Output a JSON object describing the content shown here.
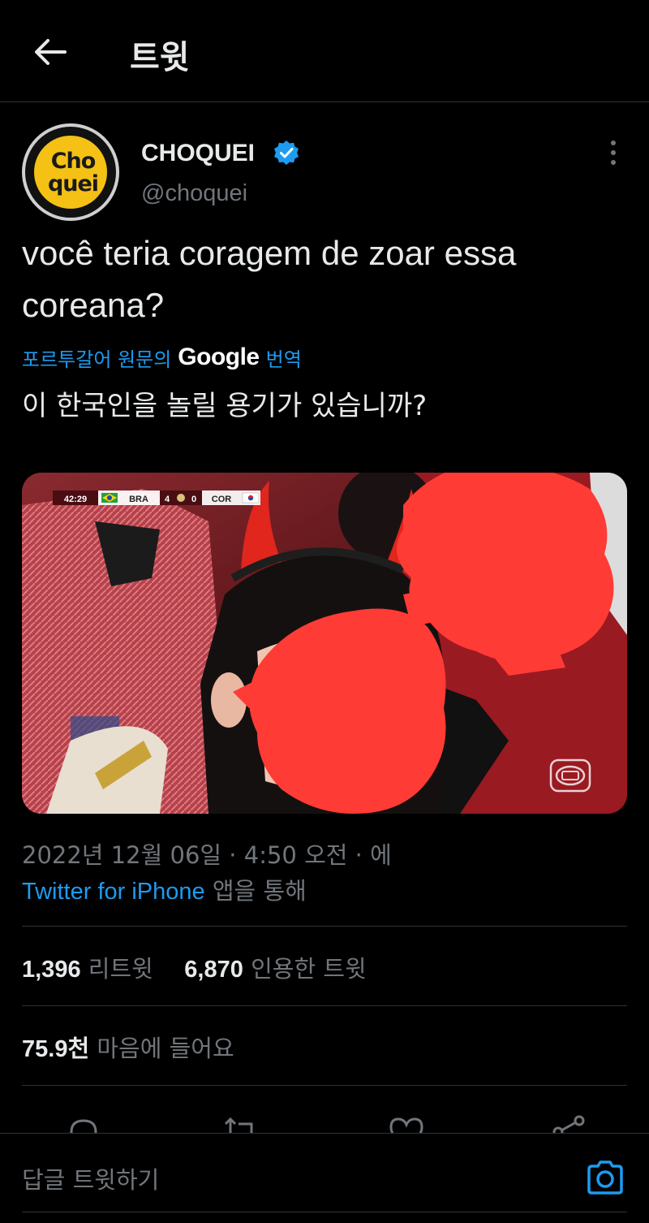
{
  "header": {
    "title": "트윗",
    "back_icon": "arrow-left-icon"
  },
  "author": {
    "avatar_text_line1": "Cho",
    "avatar_text_line2": "quei",
    "display_name": "CHOQUEI",
    "handle": "@choquei",
    "verified": true,
    "verified_color": "#1d9bf0",
    "more_icon": "more-vertical-icon"
  },
  "tweet": {
    "text": "você teria coragem de zoar essa coreana?",
    "translation_label_prefix": "포르투갈어 원문의",
    "translation_provider": "Google",
    "translation_label_suffix": "번역",
    "translated_text": "이 한국인을 놀릴 용기가 있습니까?"
  },
  "media": {
    "scoreboard_time": "42:29",
    "team_home": "BRA",
    "score_home": "4",
    "score_away": "0",
    "team_away": "COR",
    "redaction_color": "#ff3b35",
    "watermark_icon": "camera-watermark-icon"
  },
  "meta": {
    "timestamp": "2022년 12월 06일 · 4:50 오전 · 에",
    "via_client": "Twitter for iPhone",
    "via_suffix": "앱을 통해"
  },
  "stats": {
    "retweets_count": "1,396",
    "retweets_label": "리트윗",
    "quotes_count": "6,870",
    "quotes_label": "인용한 트윗",
    "likes_count": "75.9천",
    "likes_label": "마음에 들어요"
  },
  "actions": {
    "icons": [
      "reply-icon",
      "retweet-icon",
      "like-icon",
      "share-icon"
    ]
  },
  "reply": {
    "placeholder": "답글 트윗하기",
    "camera_icon": "camera-icon"
  },
  "colors": {
    "background": "#000000",
    "text_primary": "#e7e9ea",
    "text_secondary": "#71767b",
    "accent": "#1d9bf0",
    "divider": "#2f3336"
  }
}
